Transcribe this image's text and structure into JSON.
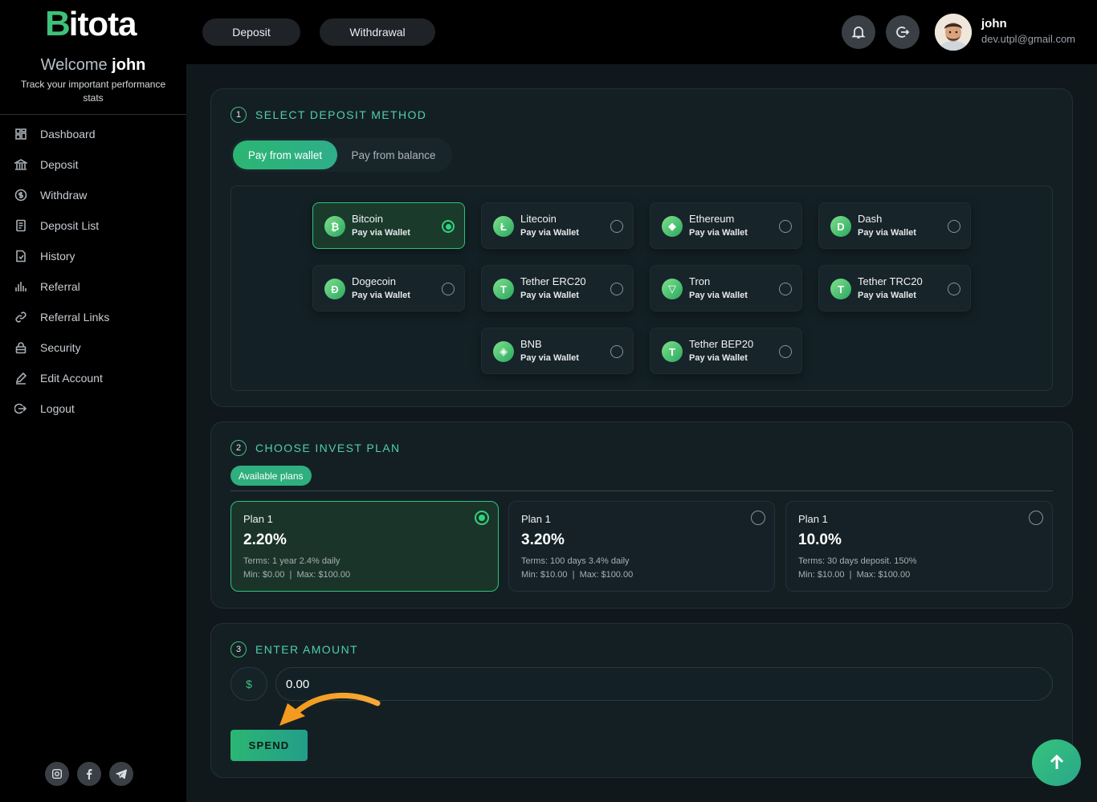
{
  "brand": {
    "logo_first": "B",
    "logo_rest": "itota"
  },
  "sidebar": {
    "welcome": "Welcome",
    "user": "john",
    "tagline": "Track your important performance stats",
    "items": [
      {
        "label": "Dashboard",
        "icon": "grid-icon"
      },
      {
        "label": "Deposit",
        "icon": "bank-icon"
      },
      {
        "label": "Withdraw",
        "icon": "dollar-circle-icon"
      },
      {
        "label": "Deposit List",
        "icon": "list-doc-icon"
      },
      {
        "label": "History",
        "icon": "history-doc-icon"
      },
      {
        "label": "Referral",
        "icon": "bar-chart-icon"
      },
      {
        "label": "Referral Links",
        "icon": "link-icon"
      },
      {
        "label": "Security",
        "icon": "lock-icon"
      },
      {
        "label": "Edit Account",
        "icon": "pencil-icon"
      },
      {
        "label": "Logout",
        "icon": "logout-icon"
      }
    ]
  },
  "topbar": {
    "deposit_label": "Deposit",
    "withdrawal_label": "Withdrawal",
    "user_name": "john",
    "user_email": "dev.utpl@gmail.com"
  },
  "step1": {
    "num": "1",
    "title": "SELECT DEPOSIT METHOD",
    "tab_wallet": "Pay from wallet",
    "tab_balance": "Pay from balance",
    "methods": [
      {
        "name": "Bitcoin",
        "sub": "Pay via Wallet",
        "glyph": "₿",
        "selected": true
      },
      {
        "name": "Litecoin",
        "sub": "Pay via Wallet",
        "glyph": "Ł",
        "selected": false
      },
      {
        "name": "Ethereum",
        "sub": "Pay via Wallet",
        "glyph": "◆",
        "selected": false
      },
      {
        "name": "Dash",
        "sub": "Pay via Wallet",
        "glyph": "D",
        "selected": false
      },
      {
        "name": "Dogecoin",
        "sub": "Pay via Wallet",
        "glyph": "Ð",
        "selected": false
      },
      {
        "name": "Tether ERC20",
        "sub": "Pay via Wallet",
        "glyph": "T",
        "selected": false
      },
      {
        "name": "Tron",
        "sub": "Pay via Wallet",
        "glyph": "▽",
        "selected": false
      },
      {
        "name": "Tether TRC20",
        "sub": "Pay via Wallet",
        "glyph": "T",
        "selected": false
      },
      {
        "name": "BNB",
        "sub": "Pay via Wallet",
        "glyph": "◈",
        "selected": false
      },
      {
        "name": "Tether BEP20",
        "sub": "Pay via Wallet",
        "glyph": "T",
        "selected": false
      }
    ]
  },
  "step2": {
    "num": "2",
    "title": "CHOOSE INVEST PLAN",
    "available": "Available plans",
    "plans": [
      {
        "title": "Plan 1",
        "rate": "2.20%",
        "terms": "Terms: 1 year 2.4% daily",
        "minmax": "Min: $0.00  |  Max: $100.00",
        "selected": true
      },
      {
        "title": "Plan 1",
        "rate": "3.20%",
        "terms": "Terms: 100 days 3.4% daily",
        "minmax": "Min: $10.00  |  Max: $100.00",
        "selected": false
      },
      {
        "title": "Plan 1",
        "rate": "10.0%",
        "terms": "Terms: 30 days deposit. 150%",
        "minmax": "Min: $10.00  |  Max: $100.00",
        "selected": false
      }
    ]
  },
  "step3": {
    "num": "3",
    "title": "ENTER AMOUNT",
    "currency": "$",
    "amount": "0.00",
    "spend_label": "SPEND"
  },
  "colors": {
    "accent": "#3ec27a",
    "teal_text": "#4fd1a5",
    "background": "#10181c"
  }
}
